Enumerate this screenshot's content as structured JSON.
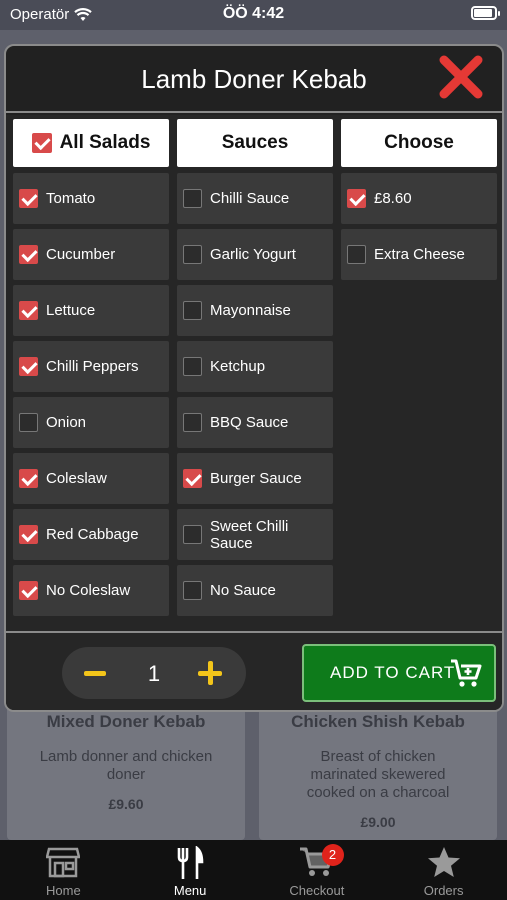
{
  "status_bar": {
    "carrier": "Operatör",
    "time": "ÖÖ 4:42"
  },
  "background_cards": [
    {
      "title": "Mixed Doner Kebab",
      "description": "Lamb donner and chicken doner",
      "price": "£9.60"
    },
    {
      "title": "Chicken Shish Kebab",
      "description": "Breast of chicken marinated skewered cooked on a charcoal",
      "price": "£9.00"
    }
  ],
  "modal": {
    "title": "Lamb Doner Kebab",
    "columns": {
      "salads": {
        "header": "All Salads",
        "header_checked": true,
        "items": [
          {
            "label": "Tomato",
            "checked": true
          },
          {
            "label": "Cucumber",
            "checked": true
          },
          {
            "label": "Lettuce",
            "checked": true
          },
          {
            "label": "Chilli Peppers",
            "checked": true
          },
          {
            "label": "Onion",
            "checked": false
          },
          {
            "label": "Coleslaw",
            "checked": true
          },
          {
            "label": "Red Cabbage",
            "checked": true
          },
          {
            "label": "No Coleslaw",
            "checked": true
          }
        ]
      },
      "sauces": {
        "header": "Sauces",
        "items": [
          {
            "label": "Chilli Sauce",
            "checked": false
          },
          {
            "label": "Garlic Yogurt",
            "checked": false
          },
          {
            "label": "Mayonnaise",
            "checked": false
          },
          {
            "label": "Ketchup",
            "checked": false
          },
          {
            "label": "BBQ Sauce",
            "checked": false
          },
          {
            "label": "Burger Sauce",
            "checked": true
          },
          {
            "label": "Sweet Chilli Sauce",
            "checked": false
          },
          {
            "label": "No Sauce",
            "checked": false
          }
        ]
      },
      "choose": {
        "header": "Choose",
        "items": [
          {
            "label": "£8.60",
            "checked": true
          },
          {
            "label": "Extra Cheese",
            "checked": false
          }
        ]
      }
    },
    "quantity": "1",
    "add_to_cart_label": "ADD TO CART"
  },
  "tabbar": {
    "tabs": [
      {
        "label": "Home",
        "icon": "store-icon"
      },
      {
        "label": "Menu",
        "icon": "cutlery-icon",
        "active": true
      },
      {
        "label": "Checkout",
        "icon": "cart-icon",
        "badge": "2"
      },
      {
        "label": "Orders",
        "icon": "star-icon"
      }
    ]
  },
  "colors": {
    "accent": "#d84a4a",
    "cart_green": "#0e7b1b",
    "stepper_yellow": "#f3c51a",
    "close_red": "#e53935"
  }
}
